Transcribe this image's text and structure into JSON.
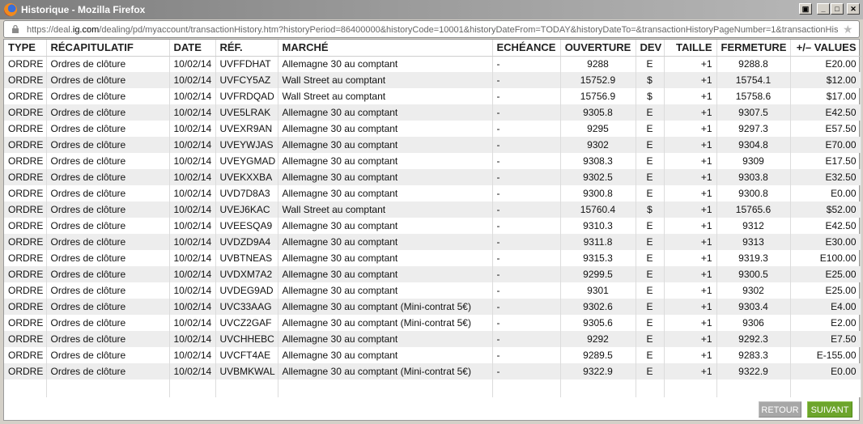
{
  "window": {
    "title": "Historique - Mozilla Firefox",
    "controls": [
      "restore-icon",
      "minimize-icon",
      "maximize-icon",
      "close-icon"
    ]
  },
  "address_bar": {
    "url_prefix": "https://deal.",
    "url_domain": "ig.com",
    "url_rest": "/dealing/pd/myaccount/transactionHistory.htm?historyPeriod=86400000&historyCode=10001&historyDateFrom=TODAY&historyDateTo=&transactionHistoryPageNumber=1&transactionHis"
  },
  "table": {
    "columns": [
      "TYPE",
      "RÉCAPITULATIF",
      "DATE",
      "RÉF.",
      "MARCHÉ",
      "ECHÉANCE",
      "OUVERTURE",
      "DEV",
      "TAILLE",
      "FERMETURE",
      "+/– VALUES"
    ],
    "rows": [
      [
        "ORDRE",
        "Ordres de clôture",
        "10/02/14",
        "UVFFDHAT",
        "Allemagne 30 au comptant",
        "-",
        "9288",
        "E",
        "+1",
        "9288.8",
        "E20.00"
      ],
      [
        "ORDRE",
        "Ordres de clôture",
        "10/02/14",
        "UVFCY5AZ",
        "Wall Street au comptant",
        "-",
        "15752.9",
        "$",
        "+1",
        "15754.1",
        "$12.00"
      ],
      [
        "ORDRE",
        "Ordres de clôture",
        "10/02/14",
        "UVFRDQAD",
        "Wall Street au comptant",
        "-",
        "15756.9",
        "$",
        "+1",
        "15758.6",
        "$17.00"
      ],
      [
        "ORDRE",
        "Ordres de clôture",
        "10/02/14",
        "UVE5LRAK",
        "Allemagne 30 au comptant",
        "-",
        "9305.8",
        "E",
        "+1",
        "9307.5",
        "E42.50"
      ],
      [
        "ORDRE",
        "Ordres de clôture",
        "10/02/14",
        "UVEXR9AN",
        "Allemagne 30 au comptant",
        "-",
        "9295",
        "E",
        "+1",
        "9297.3",
        "E57.50"
      ],
      [
        "ORDRE",
        "Ordres de clôture",
        "10/02/14",
        "UVEYWJAS",
        "Allemagne 30 au comptant",
        "-",
        "9302",
        "E",
        "+1",
        "9304.8",
        "E70.00"
      ],
      [
        "ORDRE",
        "Ordres de clôture",
        "10/02/14",
        "UVEYGMAD",
        "Allemagne 30 au comptant",
        "-",
        "9308.3",
        "E",
        "+1",
        "9309",
        "E17.50"
      ],
      [
        "ORDRE",
        "Ordres de clôture",
        "10/02/14",
        "UVEKXXBA",
        "Allemagne 30 au comptant",
        "-",
        "9302.5",
        "E",
        "+1",
        "9303.8",
        "E32.50"
      ],
      [
        "ORDRE",
        "Ordres de clôture",
        "10/02/14",
        "UVD7D8A3",
        "Allemagne 30 au comptant",
        "-",
        "9300.8",
        "E",
        "+1",
        "9300.8",
        "E0.00"
      ],
      [
        "ORDRE",
        "Ordres de clôture",
        "10/02/14",
        "UVEJ6KAC",
        "Wall Street au comptant",
        "-",
        "15760.4",
        "$",
        "+1",
        "15765.6",
        "$52.00"
      ],
      [
        "ORDRE",
        "Ordres de clôture",
        "10/02/14",
        "UVEESQA9",
        "Allemagne 30 au comptant",
        "-",
        "9310.3",
        "E",
        "+1",
        "9312",
        "E42.50"
      ],
      [
        "ORDRE",
        "Ordres de clôture",
        "10/02/14",
        "UVDZD9A4",
        "Allemagne 30 au comptant",
        "-",
        "9311.8",
        "E",
        "+1",
        "9313",
        "E30.00"
      ],
      [
        "ORDRE",
        "Ordres de clôture",
        "10/02/14",
        "UVBTNEAS",
        "Allemagne 30 au comptant",
        "-",
        "9315.3",
        "E",
        "+1",
        "9319.3",
        "E100.00"
      ],
      [
        "ORDRE",
        "Ordres de clôture",
        "10/02/14",
        "UVDXM7A2",
        "Allemagne 30 au comptant",
        "-",
        "9299.5",
        "E",
        "+1",
        "9300.5",
        "E25.00"
      ],
      [
        "ORDRE",
        "Ordres de clôture",
        "10/02/14",
        "UVDEG9AD",
        "Allemagne 30 au comptant",
        "-",
        "9301",
        "E",
        "+1",
        "9302",
        "E25.00"
      ],
      [
        "ORDRE",
        "Ordres de clôture",
        "10/02/14",
        "UVC33AAG",
        "Allemagne 30 au comptant (Mini-contrat 5€)",
        "-",
        "9302.6",
        "E",
        "+1",
        "9303.4",
        "E4.00"
      ],
      [
        "ORDRE",
        "Ordres de clôture",
        "10/02/14",
        "UVCZ2GAF",
        "Allemagne 30 au comptant (Mini-contrat 5€)",
        "-",
        "9305.6",
        "E",
        "+1",
        "9306",
        "E2.00"
      ],
      [
        "ORDRE",
        "Ordres de clôture",
        "10/02/14",
        "UVCHHEBC",
        "Allemagne 30 au comptant",
        "-",
        "9292",
        "E",
        "+1",
        "9292.3",
        "E7.50"
      ],
      [
        "ORDRE",
        "Ordres de clôture",
        "10/02/14",
        "UVCFT4AE",
        "Allemagne 30 au comptant",
        "-",
        "9289.5",
        "E",
        "+1",
        "9283.3",
        "E-155.00"
      ],
      [
        "ORDRE",
        "Ordres de clôture",
        "10/02/14",
        "UVBMKWAL",
        "Allemagne 30 au comptant (Mini-contrat 5€)",
        "-",
        "9322.9",
        "E",
        "+1",
        "9322.9",
        "E0.00"
      ]
    ]
  },
  "pagination": {
    "prev_label": "RETOUR",
    "next_label": "SUIVANT"
  },
  "colors": {
    "next_button": "#6da52c",
    "prev_button": "#a7a7a7",
    "row_alt": "#ededed"
  }
}
